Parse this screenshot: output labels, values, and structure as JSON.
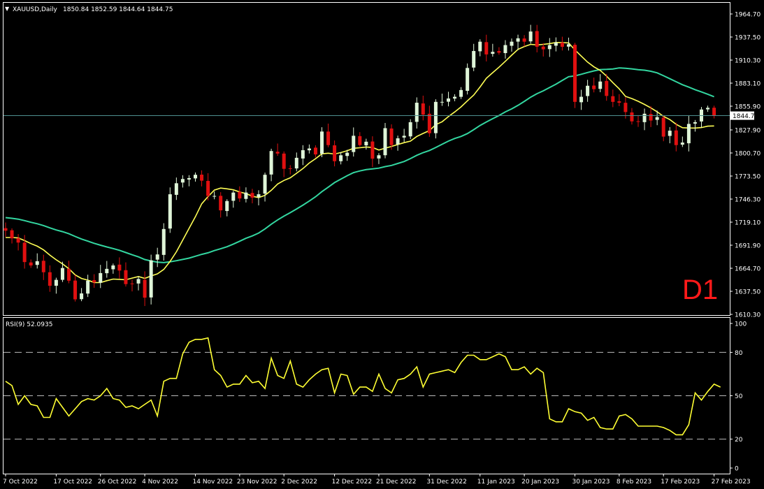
{
  "window": {
    "symbol_header": "XAUUSD,Daily",
    "ohlc_header": "1850.84 1852.59 1844.64 1844.75",
    "timeframe_badge": "D1",
    "dropdown_glyph": "▼"
  },
  "colors": {
    "background": "#000000",
    "frame": "#ffffff",
    "bull_candle": "#dff5d8",
    "bear_candle": "#e01010",
    "ma_fast": "#ffff55",
    "ma_slow": "#33d6a0",
    "rsi_line": "#ffff33",
    "price_line": "#4f8f8f",
    "badge": "#ff1a1a"
  },
  "rsi_panel": {
    "header": "RSI(9) 52.0935"
  },
  "chart_data": [
    {
      "type": "candlestick",
      "title": "XAUUSD,Daily",
      "ylim": [
        1610.3,
        1964.7
      ],
      "y_ticks": [
        "1964.70",
        "1937.50",
        "1910.30",
        "1883.10",
        "1855.90",
        "1827.90",
        "1800.70",
        "1773.50",
        "1746.30",
        "1719.10",
        "1691.90",
        "1664.70",
        "1637.50",
        "1610.30"
      ],
      "current_price": 1844.75,
      "current_price_label": "1844.75",
      "x_ticks": [
        "7 Oct 2022",
        "17 Oct 2022",
        "26 Oct 2022",
        "4 Nov 2022",
        "14 Nov 2022",
        "23 Nov 2022",
        "2 Dec 2022",
        "12 Dec 2022",
        "21 Dec 2022",
        "31 Dec 2022",
        "11 Jan 2023",
        "20 Jan 2023",
        "30 Jan 2023",
        "8 Feb 2023",
        "17 Feb 2023",
        "27 Feb 2023"
      ],
      "x_tick_bar_index": [
        0,
        8,
        15,
        22,
        30,
        37,
        44,
        52,
        59,
        67,
        75,
        82,
        90,
        97,
        104,
        112
      ],
      "closes": [
        1709,
        1700,
        1695,
        1672,
        1668,
        1673,
        1660,
        1644,
        1651,
        1665,
        1650,
        1628,
        1635,
        1650,
        1648,
        1659,
        1664,
        1668,
        1662,
        1646,
        1646,
        1652,
        1630,
        1674,
        1681,
        1711,
        1752,
        1765,
        1770,
        1771,
        1775,
        1768,
        1750,
        1750,
        1733,
        1744,
        1754,
        1747,
        1754,
        1748,
        1752,
        1775,
        1803,
        1800,
        1782,
        1782,
        1795,
        1804,
        1806,
        1799,
        1826,
        1810,
        1791,
        1798,
        1801,
        1821,
        1810,
        1814,
        1794,
        1798,
        1830,
        1810,
        1818,
        1821,
        1837,
        1860,
        1846,
        1824,
        1861,
        1861,
        1865,
        1867,
        1875,
        1901,
        1921,
        1932,
        1917,
        1920,
        1919,
        1928,
        1932,
        1936,
        1932,
        1944,
        1926,
        1923,
        1928,
        1931,
        1926,
        1929,
        1861,
        1867,
        1880,
        1876,
        1885,
        1868,
        1861,
        1860,
        1849,
        1838,
        1838,
        1847,
        1839,
        1843,
        1820,
        1827,
        1810,
        1813,
        1835,
        1837,
        1852,
        1854,
        1845
      ],
      "ma_fast_series": "yellow",
      "ma_slow_series": "green"
    },
    {
      "type": "line",
      "title": "RSI(9) 52.0935",
      "ylim": [
        0,
        100
      ],
      "y_ticks": [
        "100",
        "80",
        "50",
        "20",
        "0"
      ],
      "levels": [
        80,
        50,
        20
      ],
      "values": [
        60,
        57,
        44,
        50,
        44,
        43,
        35,
        35,
        48,
        42,
        36,
        41,
        46,
        48,
        47,
        50,
        55,
        48,
        47,
        42,
        43,
        41,
        44,
        47,
        36,
        60,
        62,
        62,
        79,
        87,
        89,
        89,
        90,
        68,
        64,
        56,
        58,
        58,
        64,
        59,
        60,
        55,
        76,
        64,
        62,
        74,
        58,
        56,
        61,
        65,
        68,
        69,
        52,
        65,
        64,
        51,
        56,
        56,
        53,
        65,
        55,
        52,
        61,
        62,
        65,
        70,
        56,
        65,
        66,
        67,
        68,
        66,
        73,
        78,
        78,
        75,
        75,
        77,
        79,
        77,
        68,
        68,
        70,
        65,
        69,
        66,
        34,
        32,
        32,
        41,
        39,
        38,
        33,
        35,
        28,
        27,
        27,
        36,
        37,
        34,
        29,
        29,
        29,
        29,
        28,
        26,
        23,
        23,
        30,
        52,
        47,
        53,
        58,
        56
      ]
    }
  ]
}
